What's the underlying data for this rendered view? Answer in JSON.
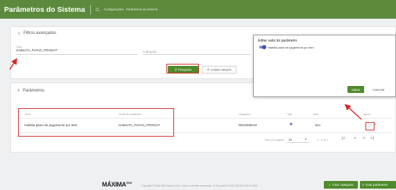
{
  "header": {
    "title": "Parâmetros do Sistema",
    "breadcrumb": "· Configurações · Parâmetros do sistema"
  },
  "filters": {
    "title": "Filtros avançados",
    "field_label": "Título",
    "field_value": "HABILITA_PLPAG_PRODUT",
    "category_placeholder": "Categoria",
    "search_label": "Pesquisar",
    "clear_label": "Limpar campos"
  },
  "params": {
    "title": "Parâmetros",
    "columns": {
      "title": "Título",
      "name": "Nome do parâmetro",
      "category": "Categoria",
      "type": "Tipo",
      "value": "Valor",
      "actions": "Ações"
    },
    "rows": [
      {
        "title": "Habilita plano de pagamento por Item",
        "name": "HABILITA_PLPAG_PRODUT",
        "category": "RENOMEAR",
        "value": "Sim"
      }
    ],
    "pagination": {
      "items_label": "Itens por página",
      "per_page": "10",
      "range": "1 - 1 de 1"
    }
  },
  "modal": {
    "title": "Editar valor do parâmetro",
    "toggle_label": "Habilita plano de pagamento por Item",
    "save_label": "Salvar",
    "cancel_label": "Cancelar"
  },
  "footer": {
    "brand": "MÁXIMA",
    "brand_suffix": "TECH",
    "copyright": "Copyright © 2008-2019 Máxima Tech. Todos os direitos reservados. v1.8.0-gcfe1d1-2021-06-16T11:59:02.045Z",
    "create_category_label": "Criar categoria",
    "create_param_label": "Criar parâmetro"
  },
  "colors": {
    "brand_green": "#5c8a3c",
    "button_green": "#4f8a2b",
    "highlight_red": "#d62828",
    "toggle_blue": "#3f51b5"
  }
}
